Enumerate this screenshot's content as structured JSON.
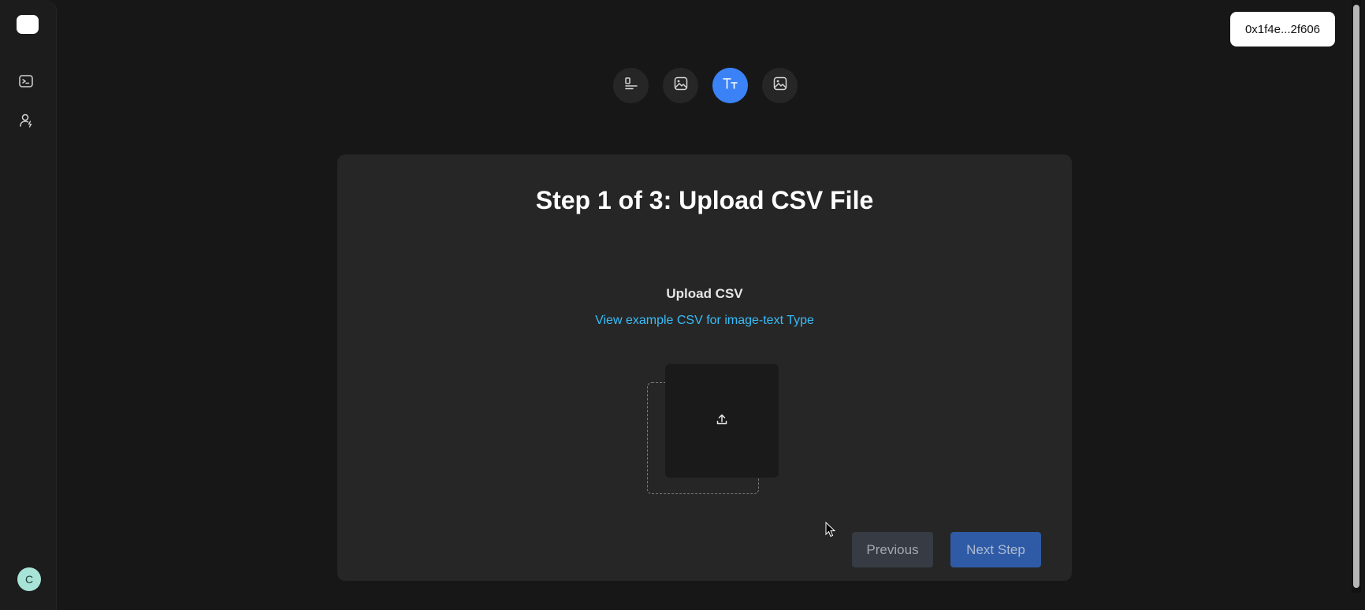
{
  "header": {
    "wallet_label": "0x1f4e...2f606"
  },
  "sidebar": {
    "items": [
      {
        "name": "console",
        "icon": "terminal-icon"
      },
      {
        "name": "profile",
        "icon": "user-icon"
      }
    ],
    "avatar_initial": "C"
  },
  "type_selector": {
    "items": [
      {
        "icon": "text-align-left-icon",
        "active": false
      },
      {
        "icon": "image-icon",
        "active": false
      },
      {
        "icon": "typography-icon",
        "active": true
      },
      {
        "icon": "image-icon",
        "active": false
      }
    ],
    "active_color": "#3b82f6"
  },
  "main": {
    "title": "Step 1 of 3: Upload CSV File",
    "upload_label": "Upload CSV",
    "example_link": "View example CSV for image-text Type",
    "upload_icon": "upload-icon"
  },
  "actions": {
    "previous_label": "Previous",
    "next_label": "Next Step"
  },
  "colors": {
    "background": "#171717",
    "card": "#262626",
    "link": "#38bdf8",
    "accent": "#3b82f6"
  }
}
